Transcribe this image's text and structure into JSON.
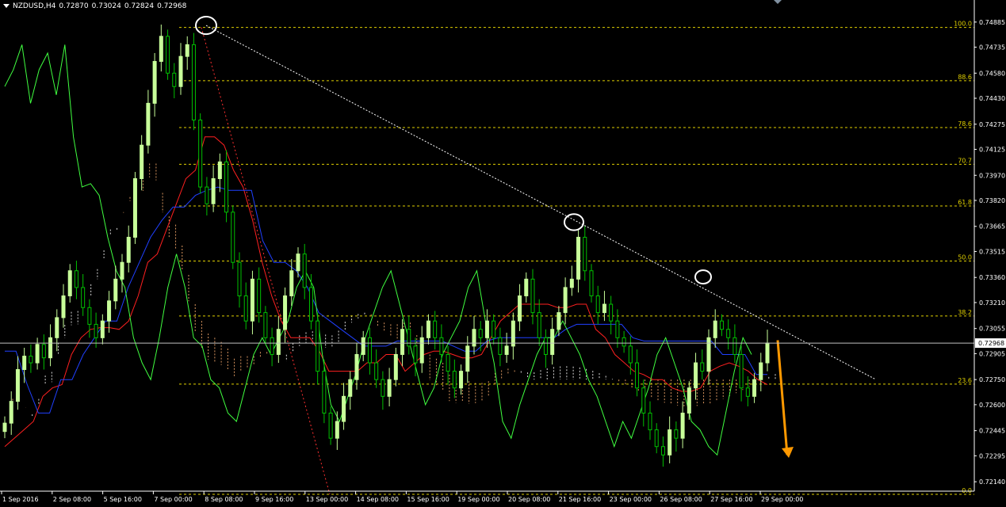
{
  "header": {
    "symbol": "NZDUSD,H4",
    "open": "0.72870",
    "high": "0.73024",
    "low": "0.72824",
    "close": "0.72968"
  },
  "colors": {
    "background": "#000000",
    "bull_candle": "#c8ff9a",
    "bear_candle": "#00c000",
    "tenkan": "#ff2020",
    "kijun": "#2040ff",
    "chikou": "#40ff40",
    "cloud_up": "#ffb070",
    "cloud_down": "#ffffff",
    "fib": "#e0d000",
    "trend": "#ffffff",
    "arrow": "#ff9900",
    "axis_text": "#ffffff"
  },
  "chart_data": {
    "type": "candlestick",
    "symbol": "NZDUSD",
    "timeframe": "H4",
    "ylim": [
      0.7215,
      0.7496
    ],
    "current_price": 0.72968,
    "y_ticks": [
      "0.74885",
      "0.74735",
      "0.74580",
      "0.74430",
      "0.74275",
      "0.74125",
      "0.73970",
      "0.73820",
      "0.73665",
      "0.73515",
      "0.73360",
      "0.73210",
      "0.73055",
      "0.72905",
      "0.72750",
      "0.72600",
      "0.72445",
      "0.72295",
      "0.72140"
    ],
    "x_ticks": [
      "1 Sep 2016",
      "2 Sep 08:00",
      "5 Sep 16:00",
      "7 Sep 00:00",
      "8 Sep 08:00",
      "9 Sep 16:00",
      "13 Sep 00:00",
      "14 Sep 08:00",
      "15 Sep 16:00",
      "19 Sep 00:00",
      "20 Sep 08:00",
      "21 Sep 16:00",
      "23 Sep 00:00",
      "26 Sep 08:00",
      "27 Sep 16:00",
      "29 Sep 00:00"
    ],
    "fib_levels": [
      {
        "label": "100.0",
        "price": 0.74853
      },
      {
        "label": "88.6",
        "price": 0.74535
      },
      {
        "label": "78.6",
        "price": 0.74255
      },
      {
        "label": "70.7",
        "price": 0.74036
      },
      {
        "label": "61.8",
        "price": 0.73787
      },
      {
        "label": "50.0",
        "price": 0.73458
      },
      {
        "label": "38.2",
        "price": 0.7313
      },
      {
        "label": "23.6",
        "price": 0.72723
      },
      {
        "label": "0.0",
        "price": 0.72065
      }
    ],
    "fib_range": {
      "high": 0.74853,
      "low": 0.72065
    },
    "candles_close": [
      0.7249,
      0.7262,
      0.7281,
      0.7289,
      0.7285,
      0.7296,
      0.7288,
      0.73,
      0.7312,
      0.7325,
      0.734,
      0.733,
      0.7318,
      0.7308,
      0.73,
      0.731,
      0.7322,
      0.7335,
      0.7345,
      0.736,
      0.7395,
      0.7415,
      0.744,
      0.7465,
      0.748,
      0.7458,
      0.745,
      0.7468,
      0.7475,
      0.743,
      0.739,
      0.738,
      0.7395,
      0.7405,
      0.7375,
      0.7345,
      0.7325,
      0.731,
      0.7335,
      0.7315,
      0.73,
      0.729,
      0.7305,
      0.7325,
      0.734,
      0.735,
      0.733,
      0.731,
      0.728,
      0.7255,
      0.724,
      0.725,
      0.7265,
      0.7275,
      0.729,
      0.73,
      0.7285,
      0.7275,
      0.7265,
      0.7275,
      0.729,
      0.7305,
      0.7295,
      0.7285,
      0.73,
      0.731,
      0.73,
      0.729,
      0.728,
      0.727,
      0.728,
      0.7295,
      0.7305,
      0.73,
      0.731,
      0.73,
      0.729,
      0.7295,
      0.731,
      0.7325,
      0.7335,
      0.7315,
      0.73,
      0.729,
      0.7305,
      0.7315,
      0.733,
      0.7335,
      0.736,
      0.734,
      0.7325,
      0.7315,
      0.732,
      0.731,
      0.73,
      0.7295,
      0.7285,
      0.727,
      0.7255,
      0.7245,
      0.7235,
      0.723,
      0.7245,
      0.724,
      0.7255,
      0.727,
      0.7285,
      0.728,
      0.73,
      0.731,
      0.7305,
      0.73,
      0.729,
      0.727,
      0.7265,
      0.7275,
      0.7285,
      0.72968
    ],
    "tenkan": [
      0.7235,
      0.724,
      0.7245,
      0.725,
      0.7265,
      0.727,
      0.7272,
      0.729,
      0.73,
      0.7305,
      0.7306,
      0.7306,
      0.7305,
      0.731,
      0.7325,
      0.7345,
      0.735,
      0.7365,
      0.738,
      0.7395,
      0.74,
      0.742,
      0.742,
      0.7415,
      0.74,
      0.739,
      0.737,
      0.7345,
      0.7325,
      0.731,
      0.73,
      0.73,
      0.73,
      0.7292,
      0.728,
      0.728,
      0.728,
      0.728,
      0.7285,
      0.7285,
      0.729,
      0.729,
      0.728,
      0.7285,
      0.729,
      0.7292,
      0.7292,
      0.729,
      0.7288,
      0.7288,
      0.729,
      0.73,
      0.731,
      0.7315,
      0.732,
      0.732,
      0.732,
      0.732,
      0.7318,
      0.7318,
      0.732,
      0.732,
      0.7305,
      0.73,
      0.729,
      0.7285,
      0.728,
      0.7278,
      0.7275,
      0.7275,
      0.727,
      0.7268,
      0.7268,
      0.727,
      0.728,
      0.7283,
      0.7285,
      0.7283,
      0.728,
      0.7275,
      0.7272
    ],
    "kijun": [
      0.7292,
      0.7292,
      0.7272,
      0.7255,
      0.7255,
      0.7275,
      0.7275,
      0.729,
      0.73,
      0.731,
      0.731,
      0.733,
      0.7345,
      0.736,
      0.737,
      0.7378,
      0.7378,
      0.7385,
      0.7388,
      0.739,
      0.7388,
      0.7388,
      0.7388,
      0.7358,
      0.7345,
      0.7345,
      0.734,
      0.733,
      0.7315,
      0.731,
      0.7305,
      0.73,
      0.7295,
      0.7295,
      0.7295,
      0.7298,
      0.7298,
      0.7298,
      0.7298,
      0.7298,
      0.7295,
      0.7292,
      0.7292,
      0.7298,
      0.73,
      0.73,
      0.73,
      0.73,
      0.73,
      0.73,
      0.7305,
      0.7308,
      0.7308,
      0.7308,
      0.7308,
      0.7308,
      0.73,
      0.7298,
      0.7298,
      0.7298,
      0.7298,
      0.7298,
      0.7298,
      0.7298,
      0.729,
      0.729,
      0.729,
      0.7278,
      0.7278
    ],
    "chikou": [
      0.745,
      0.746,
      0.7475,
      0.744,
      0.746,
      0.747,
      0.7445,
      0.7475,
      0.742,
      0.739,
      0.7392,
      0.7385,
      0.736,
      0.734,
      0.733,
      0.73,
      0.7285,
      0.7275,
      0.73,
      0.733,
      0.735,
      0.733,
      0.73,
      0.7295,
      0.7275,
      0.727,
      0.7255,
      0.725,
      0.727,
      0.729,
      0.73,
      0.729,
      0.73,
      0.731,
      0.733,
      0.734,
      0.733,
      0.729,
      0.726,
      0.725,
      0.7265,
      0.728,
      0.73,
      0.7315,
      0.733,
      0.734,
      0.732,
      0.73,
      0.728,
      0.726,
      0.727,
      0.729,
      0.73,
      0.731,
      0.733,
      0.734,
      0.731,
      0.7285,
      0.725,
      0.724,
      0.726,
      0.7275,
      0.729,
      0.73,
      0.73,
      0.731,
      0.73,
      0.729,
      0.7275,
      0.7265,
      0.725,
      0.7235,
      0.725,
      0.724,
      0.7255,
      0.727,
      0.729,
      0.73,
      0.7285,
      0.727,
      0.725,
      0.7245,
      0.7235,
      0.723,
      0.7255,
      0.728,
      0.73,
      0.729
    ]
  },
  "annotations": {
    "circles": [
      "swing-high-1",
      "swing-high-2",
      "swing-high-3"
    ],
    "arrow": "down-arrow"
  }
}
